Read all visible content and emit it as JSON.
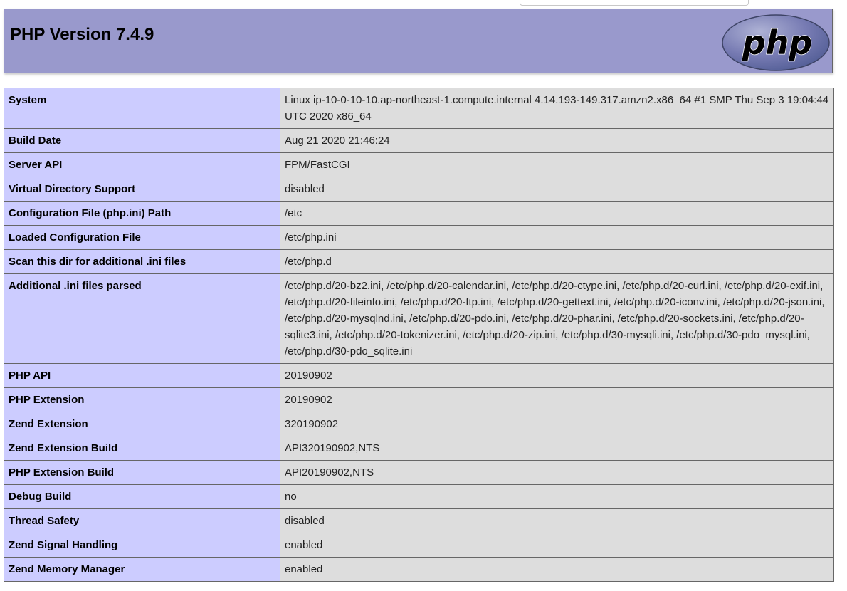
{
  "title": "PHP Version 7.4.9",
  "logo_text": "php",
  "rows": [
    {
      "key": "System",
      "value": "Linux ip-10-0-10-10.ap-northeast-1.compute.internal 4.14.193-149.317.amzn2.x86_64 #1 SMP Thu Sep 3 19:04:44 UTC 2020 x86_64"
    },
    {
      "key": "Build Date",
      "value": "Aug 21 2020 21:46:24"
    },
    {
      "key": "Server API",
      "value": "FPM/FastCGI"
    },
    {
      "key": "Virtual Directory Support",
      "value": "disabled"
    },
    {
      "key": "Configuration File (php.ini) Path",
      "value": "/etc"
    },
    {
      "key": "Loaded Configuration File",
      "value": "/etc/php.ini"
    },
    {
      "key": "Scan this dir for additional .ini files",
      "value": "/etc/php.d"
    },
    {
      "key": "Additional .ini files parsed",
      "value": "/etc/php.d/20-bz2.ini, /etc/php.d/20-calendar.ini, /etc/php.d/20-ctype.ini, /etc/php.d/20-curl.ini, /etc/php.d/20-exif.ini, /etc/php.d/20-fileinfo.ini, /etc/php.d/20-ftp.ini, /etc/php.d/20-gettext.ini, /etc/php.d/20-iconv.ini, /etc/php.d/20-json.ini, /etc/php.d/20-mysqlnd.ini, /etc/php.d/20-pdo.ini, /etc/php.d/20-phar.ini, /etc/php.d/20-sockets.ini, /etc/php.d/20-sqlite3.ini, /etc/php.d/20-tokenizer.ini, /etc/php.d/20-zip.ini, /etc/php.d/30-mysqli.ini, /etc/php.d/30-pdo_mysql.ini, /etc/php.d/30-pdo_sqlite.ini"
    },
    {
      "key": "PHP API",
      "value": "20190902"
    },
    {
      "key": "PHP Extension",
      "value": "20190902"
    },
    {
      "key": "Zend Extension",
      "value": "320190902"
    },
    {
      "key": "Zend Extension Build",
      "value": "API320190902,NTS"
    },
    {
      "key": "PHP Extension Build",
      "value": "API20190902,NTS"
    },
    {
      "key": "Debug Build",
      "value": "no"
    },
    {
      "key": "Thread Safety",
      "value": "disabled"
    },
    {
      "key": "Zend Signal Handling",
      "value": "enabled"
    },
    {
      "key": "Zend Memory Manager",
      "value": "enabled"
    }
  ],
  "colors": {
    "header_bg": "#9999cc",
    "key_bg": "#ccccff",
    "value_bg": "#dddddd",
    "border": "#666666",
    "logo_fill": "#6c7eb7"
  }
}
